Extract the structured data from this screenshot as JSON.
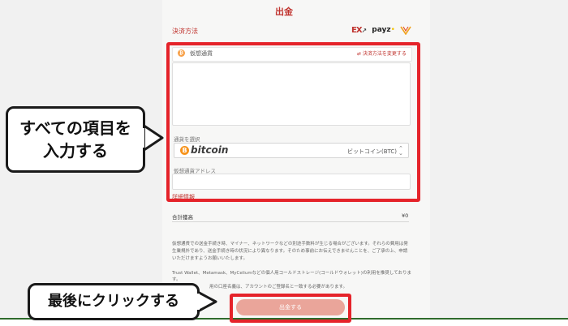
{
  "page": {
    "title": "出金"
  },
  "section": {
    "label": "決済方法"
  },
  "logos": {
    "ex": "EX",
    "payz": "payz",
    "ex_mark": "↗",
    "payz_mark": "•"
  },
  "crypto_row": {
    "icon": "₿",
    "label": "仮想通貨",
    "change_link": "⇄ 決済方法を変更する"
  },
  "currency": {
    "label": "通貨を選択",
    "brand_symbol": "B",
    "brand": "bitcoin",
    "value": "ビットコイン(BTC)",
    "caret": "⌃⌄"
  },
  "address": {
    "label": "仮想通貨アドレス",
    "value": ""
  },
  "detail_link": "詳細情報",
  "fee": {
    "label": "合計獲高",
    "value": "¥0"
  },
  "notes": [
    "仮想通貨での送金手続き時、マイナー、ネットワークなどの別途手数料が生じる場合がございます。それらの費用は発",
    "生業規外であり、送金手続き時の状況により異なります。そのため事前にお伝えできませんことを、ご了承の上、申請",
    "いただけますようお願いいたします。",
    "Trust Wallet、Metamask、MyCeliumなどの個人用コールドストレージ(コールドウォレット)の利用を推奨しております。",
    "用の口座名義は、アカウントのご登録名と一致する必要があります。"
  ],
  "callouts": {
    "fill_all": [
      "すべての項目を",
      "入力する"
    ],
    "click_last": "最後にクリックする"
  },
  "submit": {
    "label": "出金する"
  },
  "colors": {
    "accent": "#c0342f",
    "highlight": "#e5232a",
    "button": "#eaa59a",
    "bitcoin": "#f7931a"
  }
}
